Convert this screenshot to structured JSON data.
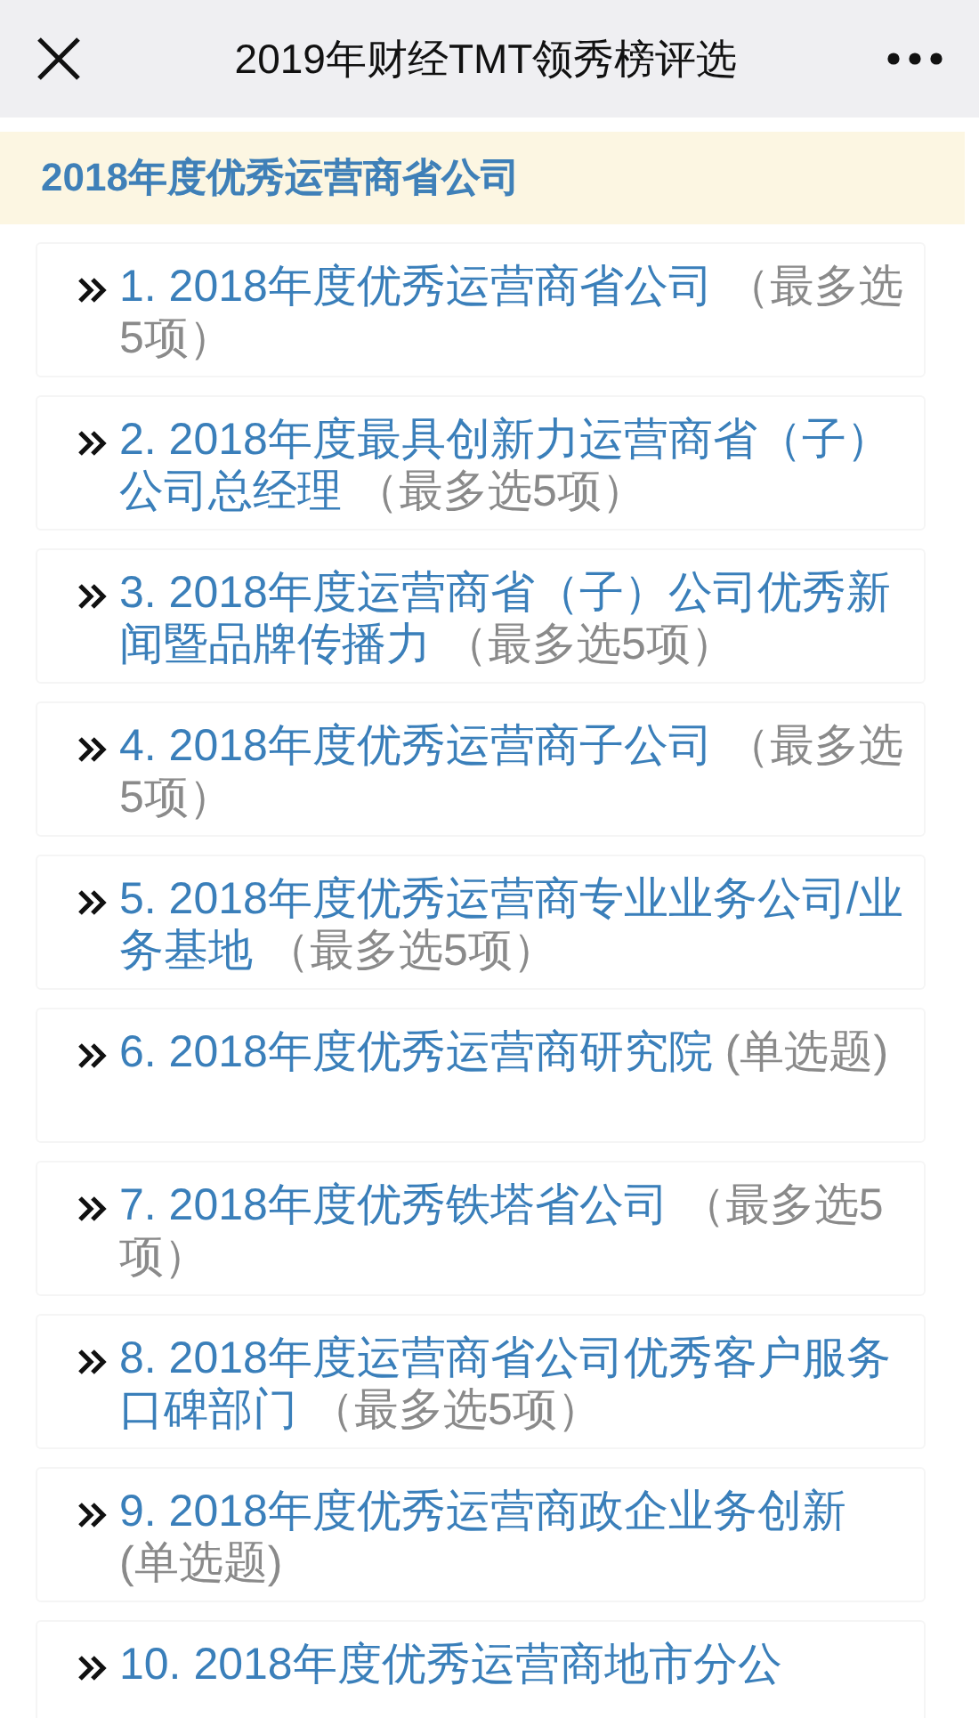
{
  "top_bar": {
    "title": "2019年财经TMT领秀榜评选"
  },
  "section": {
    "title": "2018年度优秀运营商省公司"
  },
  "items": [
    {
      "title": "1. 2018年度优秀运营商省公司",
      "hint": " （最多选5项）"
    },
    {
      "title": "2. 2018年度最具创新力运营商省（子）公司总经理",
      "hint": " （最多选5项）"
    },
    {
      "title": "3. 2018年度运营商省（子）公司优秀新闻暨品牌传播力",
      "hint": " （最多选5项）"
    },
    {
      "title": "4. 2018年度优秀运营商子公司",
      "hint": " （最多选5项）"
    },
    {
      "title": "5. 2018年度优秀运营商专业业务公司/业务基地",
      "hint": " （最多选5项）"
    },
    {
      "title": "6. 2018年度优秀运营商研究院",
      "hint": " (单选题)"
    },
    {
      "title": "7. 2018年度优秀铁塔省公司",
      "hint": " （最多选5项）"
    },
    {
      "title": "8. 2018年度运营商省公司优秀客户服务口碑部门",
      "hint": " （最多选5项）"
    },
    {
      "title": "9. 2018年度优秀运营商政企业务创新",
      "hint": " (单选题)"
    },
    {
      "title": "10. 2018年度优秀运营商地市分公"
    }
  ]
}
